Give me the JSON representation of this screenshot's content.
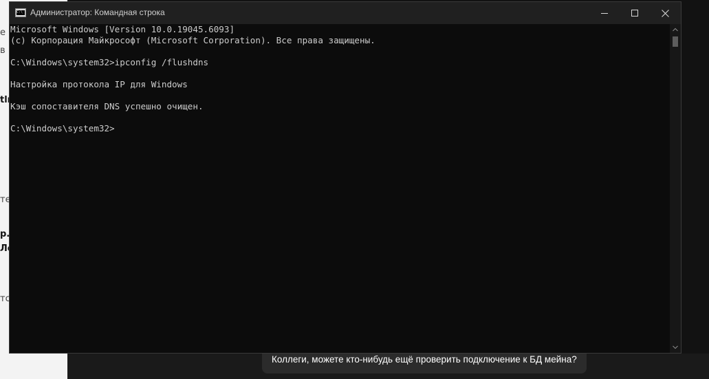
{
  "background_app": {
    "top_fragment": "",
    "left_fragments": [
      {
        "text": "e",
        "style": "normal"
      },
      {
        "text": "в",
        "style": "normal"
      },
      {
        "text": "tlr",
        "style": "bold"
      },
      {
        "text": "те",
        "style": "normal"
      },
      {
        "text": "р..",
        "style": "bold"
      },
      {
        "text": "Лс",
        "style": "bold"
      },
      {
        "text": "тся",
        "style": "normal"
      }
    ],
    "chat_message": "Коллеги, можете кто-нибудь ещё проверить подключение к БД мейна?"
  },
  "window": {
    "title": "Администратор: Командная строка",
    "icon": "cmd-icon",
    "controls": [
      "minimize-icon",
      "maximize-icon",
      "close-icon"
    ]
  },
  "console": {
    "lines": [
      "Microsoft Windows [Version 10.0.19045.6093]",
      "(c) Корпорация Майкрософт (Microsoft Corporation). Все права защищены.",
      "",
      "C:\\Windows\\system32>ipconfig /flushdns",
      "",
      "Настройка протокола IP для Windows",
      "",
      "Кэш сопоставителя DNS успешно очищен.",
      "",
      "C:\\Windows\\system32>"
    ]
  },
  "colors": {
    "console_bg": "#0c0c0c",
    "console_text": "#cccccc",
    "titlebar_bg": "#202020"
  }
}
